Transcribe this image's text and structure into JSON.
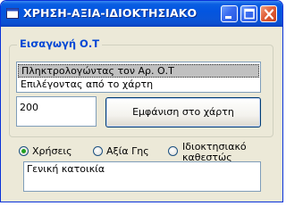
{
  "window": {
    "title": "ΧΡΗΣΗ-ΑΞΙΑ-ΙΔΙΟΚΤΗΣΙΑΚΟ",
    "app_icon": "application-window-icon",
    "controls": [
      "minimize-icon",
      "maximize-icon",
      "close-icon"
    ]
  },
  "group": {
    "legend": "Εισαγωγή Ο.Τ"
  },
  "method_list": {
    "items": [
      "Πληκτρολογώντας τον Αρ. Ο.Τ",
      "Επιλέγοντας από το χάρτη"
    ],
    "selected_index": 0
  },
  "ot_input": {
    "value": "200"
  },
  "show_button": {
    "label": "Εμφάνιση στο χάρτη"
  },
  "radios": [
    {
      "label": "Χρήσεις",
      "checked": true
    },
    {
      "label": "Αξία Γης",
      "checked": false
    },
    {
      "label_line1": "Ιδιοκτησιακό",
      "label_line2": "καθεστώς",
      "checked": false
    }
  ],
  "result": {
    "text": "Γενική κατοικία"
  },
  "colors": {
    "titlebar": "#0355e0",
    "legend": "#0046d5",
    "face": "#ece9d8",
    "radio_dot": "#21a121",
    "close_button": "#e0603a"
  }
}
